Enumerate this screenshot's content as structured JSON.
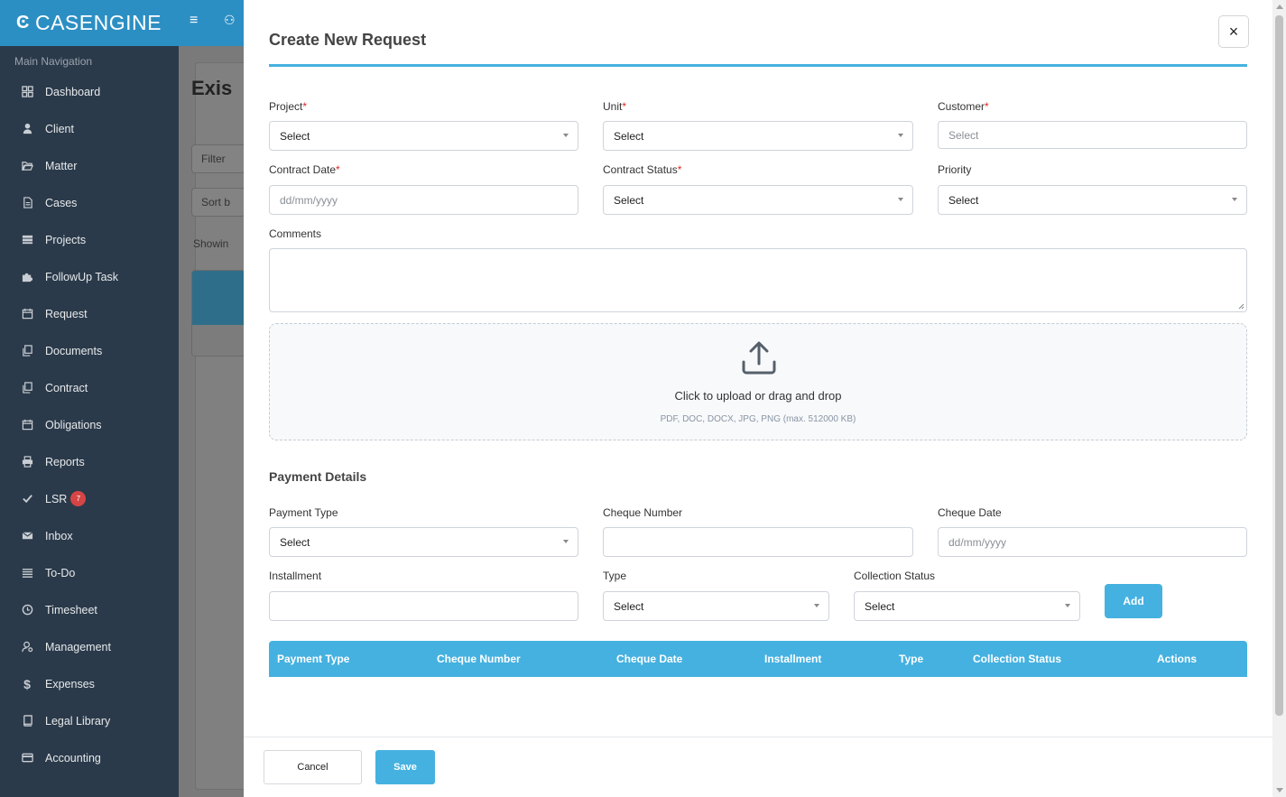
{
  "brand": {
    "logo": "CASENGINE"
  },
  "sidebar": {
    "heading": "Main Navigation",
    "items": [
      {
        "label": "Dashboard",
        "icon": "grid-icon"
      },
      {
        "label": "Client",
        "icon": "user-icon"
      },
      {
        "label": "Matter",
        "icon": "folder-open-icon"
      },
      {
        "label": "Cases",
        "icon": "file-icon"
      },
      {
        "label": "Projects",
        "icon": "stack-icon"
      },
      {
        "label": "FollowUp Task",
        "icon": "puzzle-icon"
      },
      {
        "label": "Request",
        "icon": "calendar-icon"
      },
      {
        "label": "Documents",
        "icon": "copy-icon"
      },
      {
        "label": "Contract",
        "icon": "copy-icon"
      },
      {
        "label": "Obligations",
        "icon": "calendar-icon"
      },
      {
        "label": "Reports",
        "icon": "printer-icon"
      },
      {
        "label": "LSR",
        "icon": "check-icon",
        "badge": "7"
      },
      {
        "label": "Inbox",
        "icon": "envelope-icon"
      },
      {
        "label": "To-Do",
        "icon": "list-icon"
      },
      {
        "label": "Timesheet",
        "icon": "clock-icon"
      },
      {
        "label": "Management",
        "icon": "user-gear-icon"
      },
      {
        "label": "Expenses",
        "icon": "dollar-icon"
      },
      {
        "label": "Legal Library",
        "icon": "book-icon"
      },
      {
        "label": "Accounting",
        "icon": "credit-card-icon"
      }
    ]
  },
  "background": {
    "title": "Exis",
    "filter": "Filter",
    "sort": "Sort b",
    "showing": "Showin"
  },
  "modal": {
    "title": "Create New Request",
    "close": "×",
    "fields": {
      "project": {
        "label": "Project",
        "value": "Select"
      },
      "unit": {
        "label": "Unit",
        "value": "Select"
      },
      "customer": {
        "label": "Customer",
        "placeholder": "Select"
      },
      "contract_date": {
        "label": "Contract Date",
        "placeholder": "dd/mm/yyyy"
      },
      "contract_status": {
        "label": "Contract Status",
        "value": "Select"
      },
      "priority": {
        "label": "Priority",
        "value": "Select"
      },
      "comments": {
        "label": "Comments",
        "value": ""
      }
    },
    "required_mark": "*",
    "upload": {
      "text": "Click to upload or drag and drop",
      "hint": "PDF, DOC, DOCX, JPG, PNG (max. 512000 KB)"
    },
    "payment": {
      "title": "Payment Details",
      "payment_type": {
        "label": "Payment Type",
        "value": "Select"
      },
      "cheque_number": {
        "label": "Cheque Number",
        "value": ""
      },
      "cheque_date": {
        "label": "Cheque Date",
        "placeholder": "dd/mm/yyyy"
      },
      "installment": {
        "label": "Installment",
        "value": ""
      },
      "type": {
        "label": "Type",
        "value": "Select"
      },
      "collection_status": {
        "label": "Collection Status",
        "value": "Select"
      },
      "add_label": "Add",
      "columns": [
        "Payment Type",
        "Cheque Number",
        "Cheque Date",
        "Installment",
        "Type",
        "Collection Status",
        "Actions"
      ]
    },
    "footer": {
      "cancel": "Cancel",
      "save": "Save"
    }
  },
  "colors": {
    "accent": "#45b1e0",
    "brand": "#2c8fc3",
    "sidebar": "#2b3a4a",
    "required": "#e02424",
    "badge": "#d64545"
  }
}
